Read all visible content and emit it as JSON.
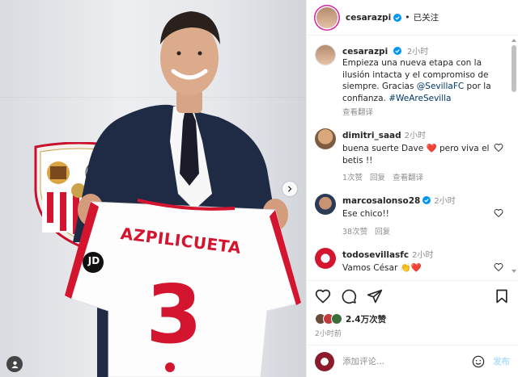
{
  "post": {
    "author": "cesarazpi",
    "follow_state": "已关注",
    "follow_sep": "•",
    "caption": {
      "username": "cesarazpi",
      "time": "2小时",
      "text_before": "Empieza una nueva etapa con la ilusión intacta y el compromiso de siempre. Gracias ",
      "mention": "@SevillaFC",
      "text_mid": " por la confianza. ",
      "hashtag": "#WeAreSevilla",
      "see_translation": "查看翻译"
    },
    "jersey": {
      "name": "AZPILICUETA",
      "number": "3",
      "sponsor": "JD"
    }
  },
  "comments": [
    {
      "username": "dimitri_saad",
      "time": "2小时",
      "text": "buena suerte Dave ",
      "emoji": "❤️",
      "text_after": " pero viva el betis !!",
      "likes": "1次赞",
      "reply": "回复",
      "translate": "查看翻译"
    },
    {
      "username": "marcosalonso28",
      "verified": true,
      "time": "2小时",
      "text": "Ese chico!!",
      "likes": "38次赞",
      "reply": "回复"
    },
    {
      "username": "todosevillasfc",
      "time": "2小时",
      "text": "Vamos César ",
      "emojis": [
        "👏",
        "❤️"
      ]
    }
  ],
  "likes": {
    "count": "2.4万次赞"
  },
  "posted": "2小时前",
  "compose": {
    "placeholder": "添加评论...",
    "post_label": "发布"
  },
  "colors": {
    "accent": "#0095f6",
    "link": "#00376b",
    "heart": "#ed4956",
    "sevilla_red": "#d4152f"
  }
}
